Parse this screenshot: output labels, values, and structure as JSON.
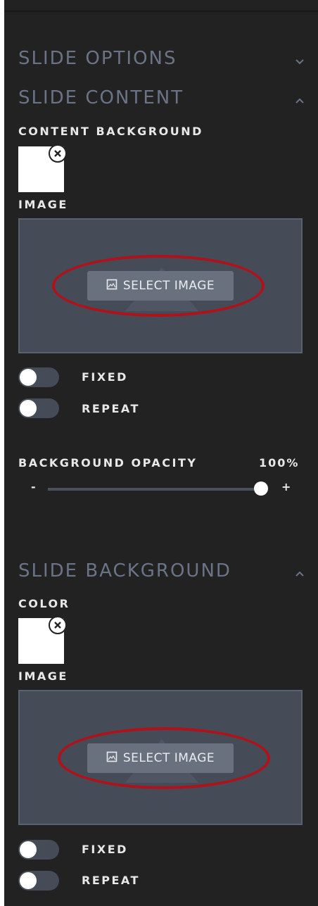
{
  "sections": {
    "slide_options": {
      "title": "SLIDE OPTIONS",
      "state": "collapsed",
      "chevron": "chevron-down-icon"
    },
    "slide_content": {
      "title": "SLIDE CONTENT",
      "state": "expanded",
      "chevron": "chevron-up-icon"
    },
    "slide_background": {
      "title": "SLIDE BACKGROUND",
      "state": "expanded",
      "chevron": "chevron-up-icon"
    }
  },
  "content": {
    "background_label": "CONTENT BACKGROUND",
    "swatch_color": "#ffffff",
    "image_label": "IMAGE",
    "select_image": "SELECT IMAGE",
    "fixed_label": "FIXED",
    "fixed_on": false,
    "repeat_label": "REPEAT",
    "repeat_on": false,
    "opacity_label": "BACKGROUND OPACITY",
    "opacity_value": "100%",
    "opacity_fraction": 1.0,
    "minus": "-",
    "plus": "+"
  },
  "background": {
    "color_label": "COLOR",
    "swatch_color": "#ffffff",
    "image_label": "IMAGE",
    "select_image": "SELECT IMAGE",
    "fixed_label": "FIXED",
    "fixed_on": false,
    "repeat_label": "REPEAT",
    "repeat_on": false
  },
  "colors": {
    "panel_bg": "#222222",
    "header_text": "#6b7486",
    "annotation": "#b0121b"
  }
}
